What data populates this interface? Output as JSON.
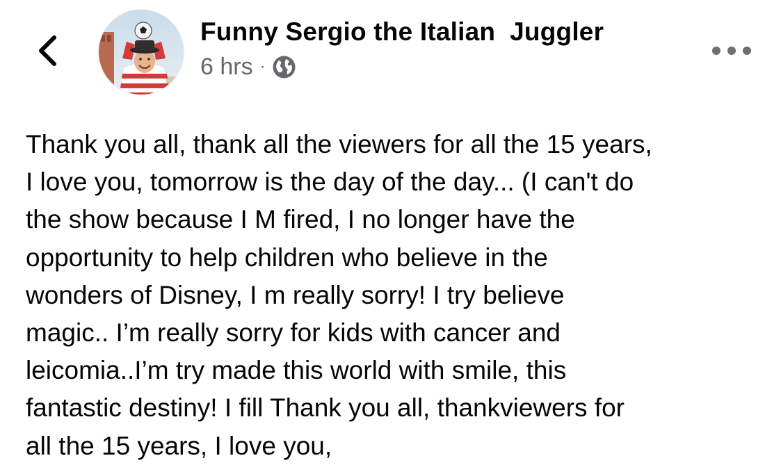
{
  "header": {
    "back_icon": "chevron-left-icon",
    "author_name": "Funny Sergio the Italian  Juggler",
    "time": "6 hrs",
    "separator": "·",
    "privacy_icon": "globe-icon",
    "more_icon": "ellipsis-icon"
  },
  "post": {
    "text": "Thank you all, thank all the viewers for all the 15 years,\nI love you, tomorrow is the day of the day... (I can't do\nthe show because I M fired, I no longer have the\nopportunity to help children who believe in the\nwonders of Disney, I m really sorry! I try believe\nmagic.. I’m really sorry for kids  with cancer and\nleicomia..I’m try made this world with smile, this\nfantastic destiny! I fill Thank you all, thankviewers for\nall the 15 years, I love you,"
  },
  "colors": {
    "text_primary": "#050505",
    "text_secondary": "#65676b",
    "icon": "#6c6f74"
  }
}
